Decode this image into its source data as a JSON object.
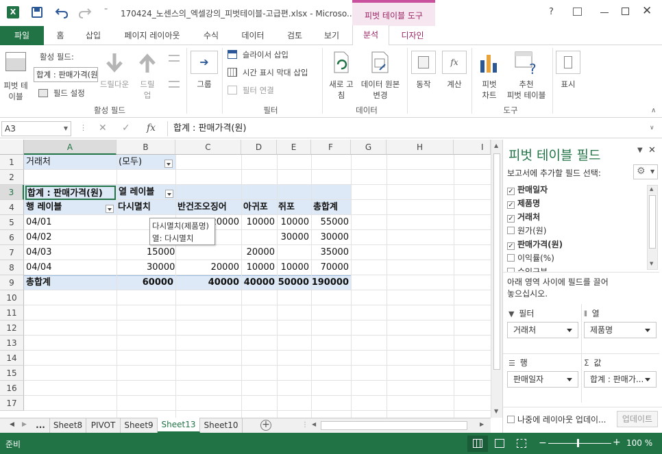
{
  "window": {
    "title": "170424_노센스의_엑셀강의_피벗테이블-고급편.xlsx - Microso...",
    "context_tab": "피벗 테이블 도구",
    "help": "?"
  },
  "tabs": [
    {
      "label": "파일"
    },
    {
      "label": "홈"
    },
    {
      "label": "삽입"
    },
    {
      "label": "페이지 레이아웃"
    },
    {
      "label": "수식"
    },
    {
      "label": "데이터"
    },
    {
      "label": "검토"
    },
    {
      "label": "보기"
    },
    {
      "label": "분석"
    },
    {
      "label": "디자인"
    }
  ],
  "ribbon": {
    "pivot_table_l1": "피벗 테",
    "pivot_table_l2": "이블",
    "active_field_label": "활성 필드:",
    "active_field_value": "합계 : 판매가격(원)",
    "field_settings": "필드 설정",
    "drill_down": "드릴다운",
    "drill_up_l1": "드릴",
    "drill_up_l2": "업",
    "group_active_field": "활성 필드",
    "group": "그룹",
    "insert_slicer": "슬라이서 삽입",
    "insert_timeline": "시간 표시 막대 삽입",
    "filter_connections": "필터 연결",
    "group_filter": "필터",
    "refresh_l1": "새로 고",
    "refresh_l2": "침",
    "change_source_l1": "데이터 원본",
    "change_source_l2": "변경",
    "group_data": "데이터",
    "actions": "동작",
    "calculations": "계산",
    "pivot_chart_l1": "피벗",
    "pivot_chart_l2": "차트",
    "recommended_l1": "추천",
    "recommended_l2": "피벗 테이블",
    "group_tools": "도구",
    "show": "표시"
  },
  "formula_bar": {
    "name_box": "A3",
    "formula": "합계 : 판매가격(원)"
  },
  "columns": [
    "A",
    "B",
    "C",
    "D",
    "E",
    "F",
    "G",
    "H",
    "I"
  ],
  "rows": [
    "1",
    "2",
    "3",
    "4",
    "5",
    "6",
    "7",
    "8",
    "9",
    "10",
    "11",
    "12",
    "13",
    "14",
    "15",
    "16",
    "17"
  ],
  "cells": {
    "a1": "거래처",
    "b1": "(모두)",
    "a3": "합계 : 판매가격(원)",
    "b3": "열 레이블",
    "a4": "행 레이블",
    "b4": "다시멸치",
    "c4": "반건조오징어",
    "d4": "아귀포",
    "e4": "쥐포",
    "f4": "총합계",
    "a5": "04/01",
    "b5": "1",
    "c5": "20000",
    "d5": "10000",
    "e5": "10000",
    "f5": "55000",
    "a6": "04/02",
    "e6": "30000",
    "f6": "30000",
    "a7": "04/03",
    "b7": "15000",
    "d7": "20000",
    "f7": "35000",
    "a8": "04/04",
    "b8": "30000",
    "c8": "20000",
    "d8": "10000",
    "e8": "10000",
    "f8": "70000",
    "a9": "총합계",
    "b9": "60000",
    "c9": "40000",
    "d9": "40000",
    "e9": "50000",
    "f9": "190000"
  },
  "tooltip": {
    "line1": "다시멸치(제품명)",
    "line2": "열: 다시멸치"
  },
  "sheets": {
    "more": "...",
    "items": [
      "Sheet8",
      "PIVOT",
      "Sheet9",
      "Sheet13",
      "Sheet10"
    ],
    "active": "Sheet13"
  },
  "status": {
    "ready": "준비",
    "zoom": "100 %"
  },
  "pivot_pane": {
    "title": "피벗 테이블 필드",
    "choose_label": "보고서에 추가할 필드 선택:",
    "fields": [
      {
        "label": "판매일자",
        "checked": true
      },
      {
        "label": "제품명",
        "checked": true
      },
      {
        "label": "거래처",
        "checked": true
      },
      {
        "label": "원가(원)",
        "checked": false
      },
      {
        "label": "판매가격(원)",
        "checked": true
      },
      {
        "label": "이익률(%)",
        "checked": false
      },
      {
        "label": "수익구분",
        "checked": false
      }
    ],
    "drag_hint_l1": "아래 영역 사이에 필드를 끌어",
    "drag_hint_l2": "놓으십시오.",
    "filter_area": "필터",
    "column_area": "열",
    "row_area": "행",
    "value_area": "값",
    "filter_value": "거래처",
    "column_value": "제품명",
    "row_value": "판매일자",
    "value_value": "합계 : 판매가...",
    "defer_label": "나중에 레이아웃 업데이...",
    "update_button": "업데이트"
  }
}
